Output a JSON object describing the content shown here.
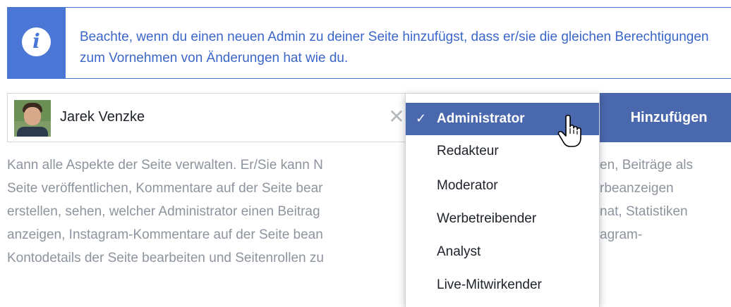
{
  "notice": {
    "icon": "info-icon",
    "glyph": "i",
    "text": "Beachte, wenn du einen neuen Admin zu deiner Seite hinzufügst, dass er/sie die gleichen Berechtigungen zum Vornehmen von Änderungen hat wie du."
  },
  "user_field": {
    "name": "Jarek Venzke",
    "clear_glyph": "✕"
  },
  "add_button": {
    "label": "Hinzufügen"
  },
  "description": "Kann alle Aspekte der Seite verwalten. Er/Sie kann N…en, Beiträge als Seite veröffentlichen, Kommentare auf der Seite bear… …rbeanzeigen erstellen, sehen, welcher Administrator einen Beitrag … …nat, Statistiken anzeigen, Instagram-Kommentare auf der Seite bean… …agram-Kontodetails der Seite bearbeiten und Seitenrollen zu…",
  "description_lines": [
    "Kann alle Aspekte der Seite verwalten. Er/Sie kann N",
    "Seite veröffentlichen, Kommentare auf der Seite bear",
    "erstellen, sehen, welcher Administrator einen Beitrag",
    "anzeigen, Instagram-Kommentare auf der Seite bean",
    "Kontodetails der Seite bearbeiten und Seitenrollen zu"
  ],
  "description_right": [
    "en, Beiträge als",
    "rbeanzeigen",
    "nat, Statistiken",
    "agram-"
  ],
  "role_menu": {
    "check_glyph": "✓",
    "items": [
      {
        "label": "Administrator",
        "selected": true
      },
      {
        "label": "Redakteur",
        "selected": false
      },
      {
        "label": "Moderator",
        "selected": false
      },
      {
        "label": "Werbetreibender",
        "selected": false
      },
      {
        "label": "Analyst",
        "selected": false
      },
      {
        "label": "Live-Mitwirkender",
        "selected": false
      }
    ]
  },
  "colors": {
    "accent": "#4a76d6",
    "button": "#4a68ad",
    "muted_text": "#8d949e"
  }
}
